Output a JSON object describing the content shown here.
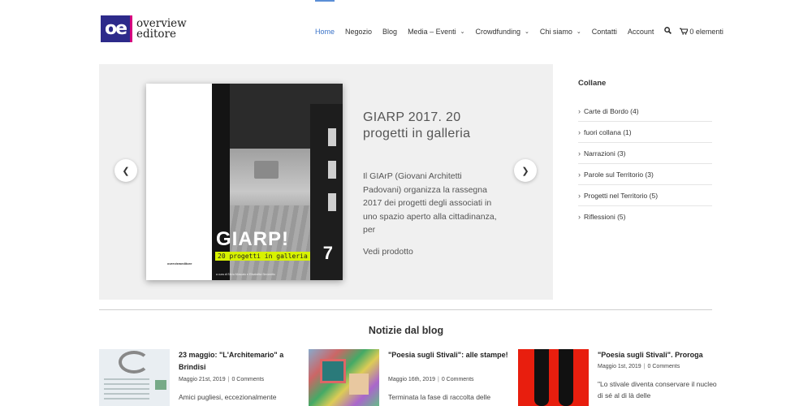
{
  "header": {
    "logo_mark": "oe",
    "logo_line1": "overview",
    "logo_line2": "editore",
    "nav": [
      {
        "label": "Home",
        "active": true,
        "dropdown": false
      },
      {
        "label": "Negozio",
        "active": false,
        "dropdown": false
      },
      {
        "label": "Blog",
        "active": false,
        "dropdown": false
      },
      {
        "label": "Media – Eventi",
        "active": false,
        "dropdown": true
      },
      {
        "label": "Crowdfunding",
        "active": false,
        "dropdown": true
      },
      {
        "label": "Chi siamo",
        "active": false,
        "dropdown": true
      },
      {
        "label": "Contatti",
        "active": false,
        "dropdown": false
      },
      {
        "label": "Account",
        "active": false,
        "dropdown": false
      }
    ],
    "search_icon": "search-icon",
    "cart_icon": "cart-icon",
    "cart_label": "0 elementi",
    "accent": "#3a73c8"
  },
  "slider": {
    "cover": {
      "publisher": "overvieweditore",
      "title": "GIARP!",
      "subtitle": "20 progetti in galleria",
      "credit": "a cura di Silvia Moscato e Elisabetta Simonetto",
      "side_mark": "7"
    },
    "title": "GIARP 2017. 20 progetti in galleria",
    "description": "Il GIArP (Giovani Architetti Padovani) organizza la rassegna 2017 dei progetti degli associati in uno spazio aperto alla cittadinanza, per",
    "link": "Vedi prodotto",
    "prev_icon": "chevron-left-icon",
    "next_icon": "chevron-right-icon"
  },
  "sidebar": {
    "title": "Collane",
    "items": [
      {
        "label": "Carte di Bordo (4)"
      },
      {
        "label": "fuori collana (1)"
      },
      {
        "label": "Narrazioni (3)"
      },
      {
        "label": "Parole sul Territorio (3)"
      },
      {
        "label": "Progetti nel Territorio (5)"
      },
      {
        "label": "Riflessioni (5)"
      }
    ]
  },
  "blog": {
    "title": "Notizie dal blog",
    "posts": [
      {
        "title": "23 maggio: \"L'Architemario\" a Brindisi",
        "date": "Maggio 21st, 2019",
        "comments": "0 Comments",
        "excerpt": "Amici pugliesi, eccezionalmente"
      },
      {
        "title": "\"Poesia sugli Stivali\": alle stampe!",
        "date": "Maggio 16th, 2019",
        "comments": "0 Comments",
        "excerpt": "Terminata la fase di raccolta delle"
      },
      {
        "title": "\"Poesia sugli Stivali\". Proroga",
        "date": "Maggio 1st, 2019",
        "comments": "0 Comments",
        "excerpt": "\"Lo stivale diventa conservare il nucleo di sé al di là delle"
      }
    ]
  }
}
